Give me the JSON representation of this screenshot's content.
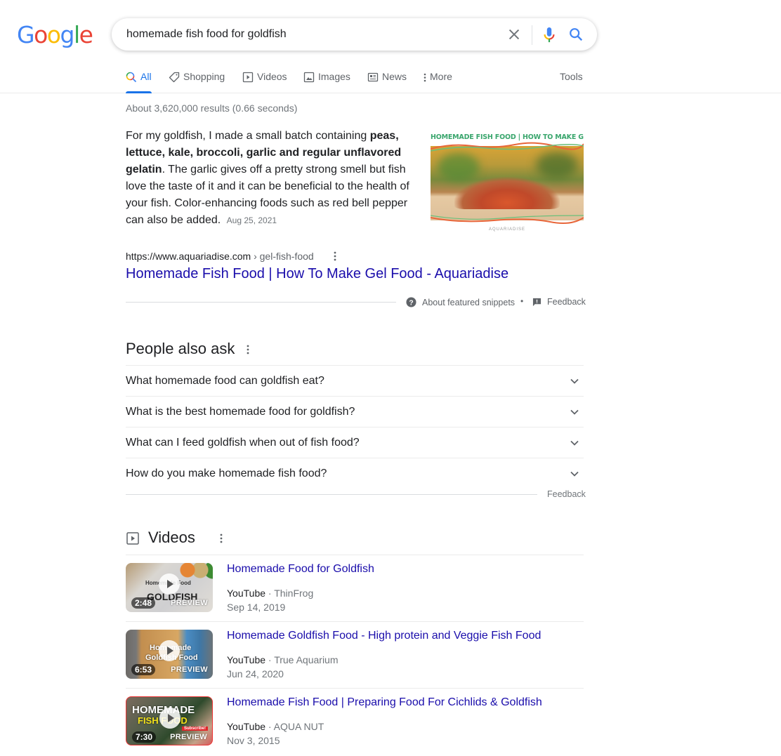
{
  "logo": {
    "letters": [
      "G",
      "o",
      "o",
      "g",
      "l",
      "e"
    ],
    "colors": [
      "#4285f4",
      "#ea4335",
      "#fbbc05",
      "#4285f4",
      "#34a853",
      "#ea4335"
    ]
  },
  "search": {
    "query": "homemade fish food for goldfish",
    "clear_icon": "close-icon",
    "voice_icon": "microphone-icon",
    "search_icon": "search-icon"
  },
  "tabs": [
    {
      "label": "All",
      "icon": "search-icon",
      "active": true
    },
    {
      "label": "Shopping",
      "icon": "tag-icon"
    },
    {
      "label": "Videos",
      "icon": "play-box-icon"
    },
    {
      "label": "Images",
      "icon": "image-icon"
    },
    {
      "label": "News",
      "icon": "newspaper-icon"
    },
    {
      "label": "More",
      "icon": "more-vert-icon"
    }
  ],
  "tools_label": "Tools",
  "result_stats": "About 3,620,000 results (0.66 seconds)",
  "featured_snippet": {
    "text_prefix": "For my goldfish, I made a small batch containing ",
    "text_bold": "peas, lettuce, kale, broccoli, garlic and regular unflavored gelatin",
    "text_suffix": ". The garlic gives off a pretty strong smell but fish love the taste of it and it can be beneficial to the health of your fish. Color-enhancing foods such as red bell pepper can also be added.",
    "date": "Aug 25, 2021",
    "image_caption": "HOMEMADE FISH FOOD | HOW TO MAKE GEL FOOD",
    "image_brand": "AQUARIADISE",
    "cite_url": "https://www.aquariadise.com",
    "cite_crumb": " › gel-fish-food",
    "title": "Homemade Fish Food | How To Make Gel Food - Aquariadise",
    "about_label": "About featured snippets",
    "separator": "•",
    "feedback_label": "Feedback"
  },
  "people_also_ask": {
    "title": "People also ask",
    "questions": [
      "What homemade food can goldfish eat?",
      "What is the best homemade food for goldfish?",
      "What can I feed goldfish when out of fish food?",
      "How do you make homemade fish food?"
    ],
    "feedback_label": "Feedback"
  },
  "videos": {
    "title": "Videos",
    "items": [
      {
        "title": "Homemade Food for Goldfish",
        "source": "YouTube",
        "channel": " · ThinFrog",
        "date": "Sep 14, 2019",
        "duration": "2:48",
        "preview": "PREVIEW",
        "thumb_text_1": "Homemade Food",
        "thumb_text_2": "GOLDFISH"
      },
      {
        "title": "Homemade Goldfish Food - High protein and Veggie Fish Food",
        "source": "YouTube",
        "channel": " · True Aquarium",
        "date": "Jun 24, 2020",
        "duration": "6:53",
        "preview": "PREVIEW",
        "thumb_text_1": "Homemade",
        "thumb_text_2": "Goldfish Food"
      },
      {
        "title": "Homemade Fish Food | Preparing Food For Cichlids & Goldfish",
        "source": "YouTube",
        "channel": " · AQUA NUT",
        "date": "Nov 3, 2015",
        "duration": "7:30",
        "preview": "PREVIEW",
        "thumb_text_1": "HOMEMADE",
        "thumb_text_2": "FISH FOOD",
        "thumb_text_3": "Subscribe!"
      }
    ]
  }
}
